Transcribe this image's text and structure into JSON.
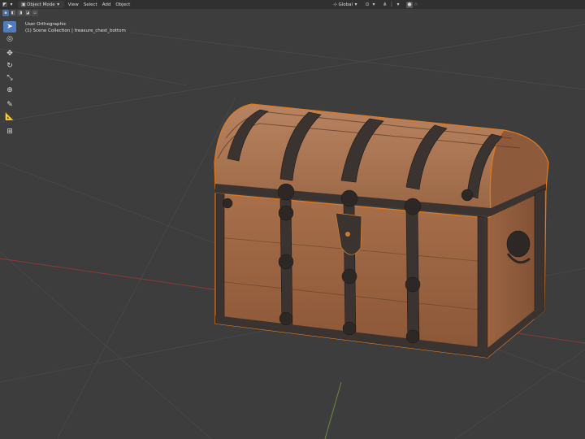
{
  "header": {
    "mode_label": "Object Mode",
    "menus": [
      "View",
      "Select",
      "Add",
      "Object"
    ],
    "orientation_label": "Global"
  },
  "overlay": {
    "view_name": "User Orthographic",
    "collection_info": "(1) Scene Collection | treasure_chest_bottom"
  },
  "toolbar": {
    "tools": [
      "select-box",
      "cursor",
      "move",
      "rotate",
      "scale",
      "transform",
      "annotate",
      "measure",
      "add-cube"
    ]
  },
  "colors": {
    "viewport_bg": "#3d3d3d",
    "header_bg": "#303030",
    "selection_outline": "#e07a1f",
    "active_tool": "#4f7cc0",
    "x_axis": "#8a3a3a",
    "y_axis": "#6a8a3a"
  }
}
